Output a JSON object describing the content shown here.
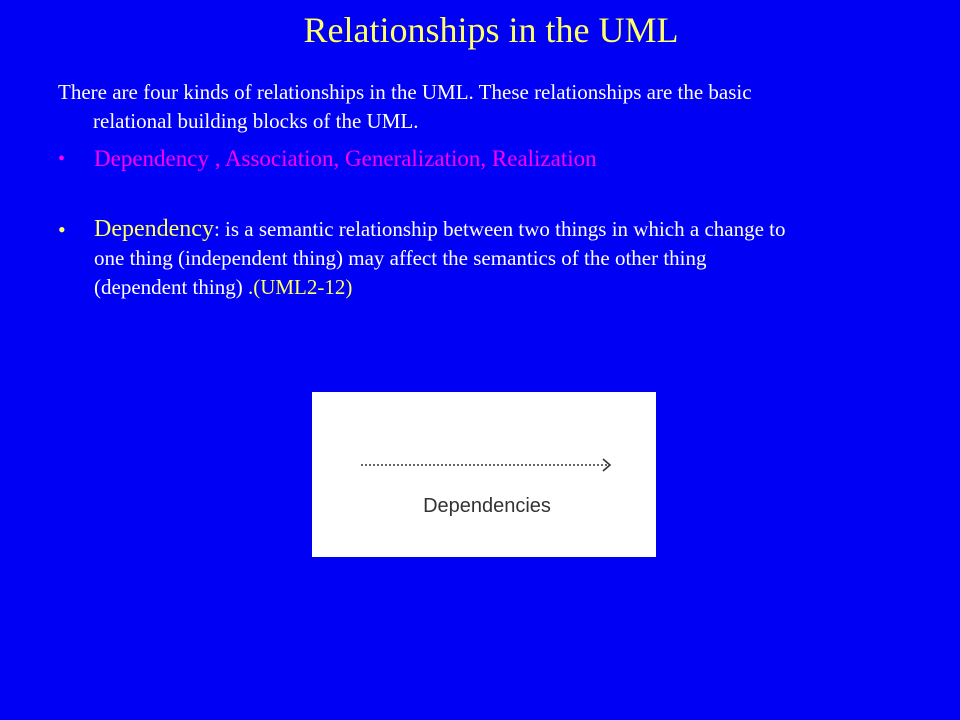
{
  "slide": {
    "title": "Relationships in the UML",
    "intro_line1": "There are four kinds of relationships in the UML. These relationships are the basic",
    "intro_line2": "relational building blocks of the UML.",
    "bullets": [
      {
        "marker": "•",
        "text": "Dependency , Association, Generalization, Realization"
      },
      {
        "marker": "•",
        "term": "Dependency",
        "colon": ":",
        "text_line1": " is a semantic relationship between two things in which a change to",
        "text_line2": "one thing (independent thing) may affect the semantics of the other thing",
        "text_line3": "(dependent thing) ",
        "reference": ".(UML2-12)"
      }
    ]
  },
  "figure": {
    "caption": "Dependencies",
    "arrow_icon": "dashed-open-arrow-icon"
  },
  "colors": {
    "background": "#0000f5",
    "title": "#ffff66",
    "body_text": "#ffffff",
    "highlight_list": "#ff00ff",
    "term": "#ffff66",
    "figure_background": "#ffffff",
    "figure_text": "#333333"
  }
}
